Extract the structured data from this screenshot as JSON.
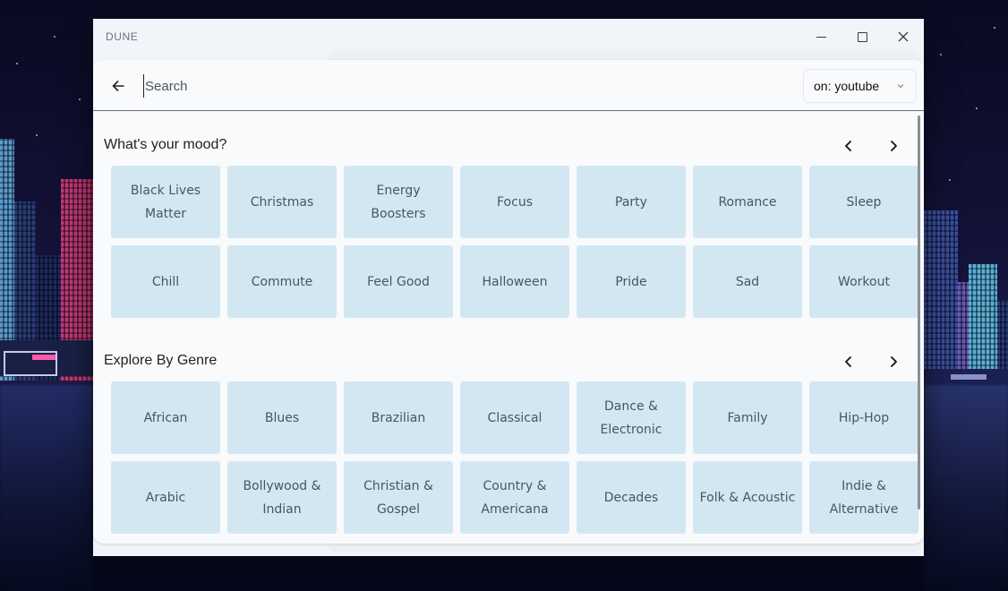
{
  "window": {
    "title": "DUNE"
  },
  "search": {
    "placeholder": "Search",
    "value": ""
  },
  "source_select": {
    "label": "on: youtube"
  },
  "mood_section": {
    "title": "What's your mood?",
    "rows": [
      [
        "Black Lives Matter",
        "Christmas",
        "Energy Boosters",
        "Focus",
        "Party",
        "Romance",
        "Sleep"
      ],
      [
        "Chill",
        "Commute",
        "Feel Good",
        "Halloween",
        "Pride",
        "Sad",
        "Workout"
      ]
    ]
  },
  "genre_section": {
    "title": "Explore By Genre",
    "rows": [
      [
        "African",
        "Blues",
        "Brazilian",
        "Classical",
        "Dance & Electronic",
        "Family",
        "Hip-Hop"
      ],
      [
        "Arabic",
        "Bollywood & Indian",
        "Christian & Gospel",
        "Country & Americana",
        "Decades",
        "Folk & Acoustic",
        "Indie & Alternative"
      ]
    ]
  },
  "colors": {
    "tile_bg": "#d3e7f3",
    "tile_text": "#4a5560",
    "sheet_bg": "#f8fafc"
  },
  "icons": {
    "back": "arrow-left-icon",
    "prev": "chevron-left-icon",
    "next": "chevron-right-icon",
    "dropdown": "chevron-down-icon",
    "minimize": "minimize-icon",
    "maximize": "maximize-icon",
    "close": "close-icon"
  }
}
